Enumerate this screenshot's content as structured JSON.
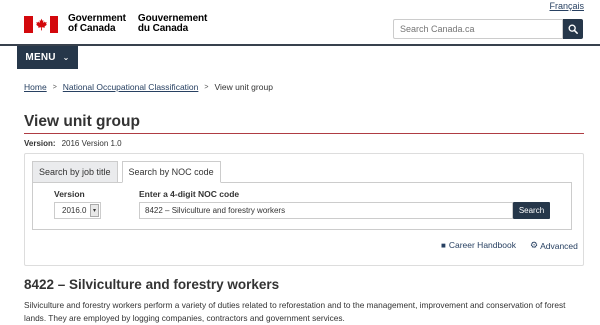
{
  "header": {
    "language_link": "Français",
    "gov_en_line1": "Government",
    "gov_en_line2": "of Canada",
    "gov_fr_line1": "Gouvernement",
    "gov_fr_line2": "du Canada",
    "search_placeholder": "Search Canada.ca",
    "menu_label": "MENU",
    "flag_color": "#d3080c",
    "nav_color": "#26374a"
  },
  "breadcrumb": {
    "items": [
      "Home",
      "National Occupational Classification",
      "View unit group"
    ],
    "separator": ">"
  },
  "page": {
    "title": "View unit group",
    "version_label": "Version:",
    "version_value": "2016 Version 1.0",
    "title_rule_color": "#af3c43"
  },
  "search_panel": {
    "tabs": [
      {
        "label": "Search by job title",
        "active": false
      },
      {
        "label": "Search by NOC code",
        "active": true
      }
    ],
    "version_label": "Version",
    "version_selected": "2016.0",
    "noc_label": "Enter a 4-digit NOC code",
    "noc_value": "8422 – Silviculture and forestry workers",
    "search_button": "Search",
    "career_handbook": "Career Handbook",
    "advanced": "Advanced"
  },
  "content": {
    "heading": "8422 – Silviculture and forestry workers",
    "description": "Silviculture and forestry workers perform a variety of duties related to reforestation and to the management, improvement and conservation of forest lands. They are employed by logging companies, contractors and government services."
  }
}
